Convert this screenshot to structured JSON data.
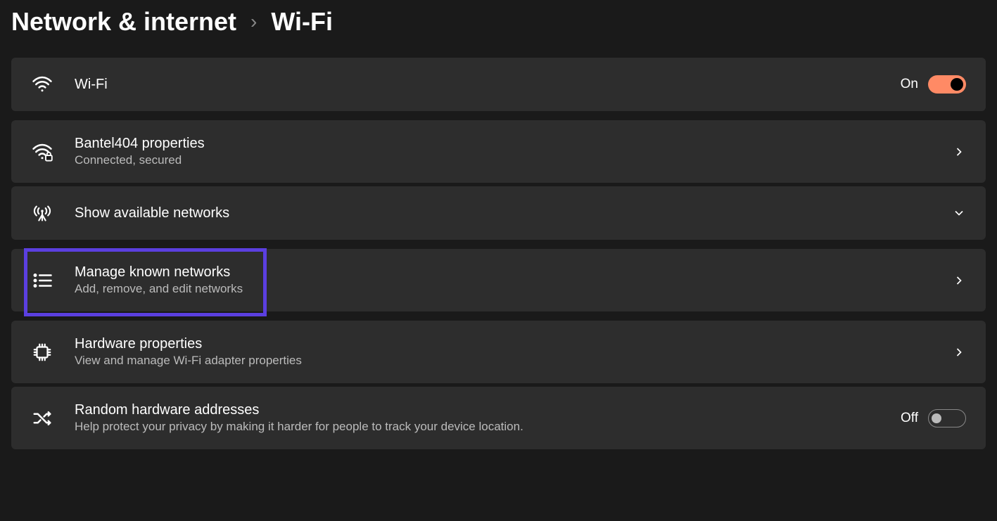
{
  "breadcrumb": {
    "parent": "Network & internet",
    "current": "Wi-Fi"
  },
  "rows": {
    "wifi": {
      "title": "Wi-Fi",
      "toggle_label": "On",
      "toggle_state": "on"
    },
    "network_props": {
      "title": "Bantel404 properties",
      "subtitle": "Connected, secured"
    },
    "available": {
      "title": "Show available networks"
    },
    "manage": {
      "title": "Manage known networks",
      "subtitle": "Add, remove, and edit networks"
    },
    "hardware": {
      "title": "Hardware properties",
      "subtitle": "View and manage Wi-Fi adapter properties"
    },
    "random": {
      "title": "Random hardware addresses",
      "subtitle": "Help protect your privacy by making it harder for people to track your device location.",
      "toggle_label": "Off",
      "toggle_state": "off"
    }
  },
  "colors": {
    "accent_toggle": "#ff8a65",
    "highlight_border": "#5b3fe0"
  }
}
